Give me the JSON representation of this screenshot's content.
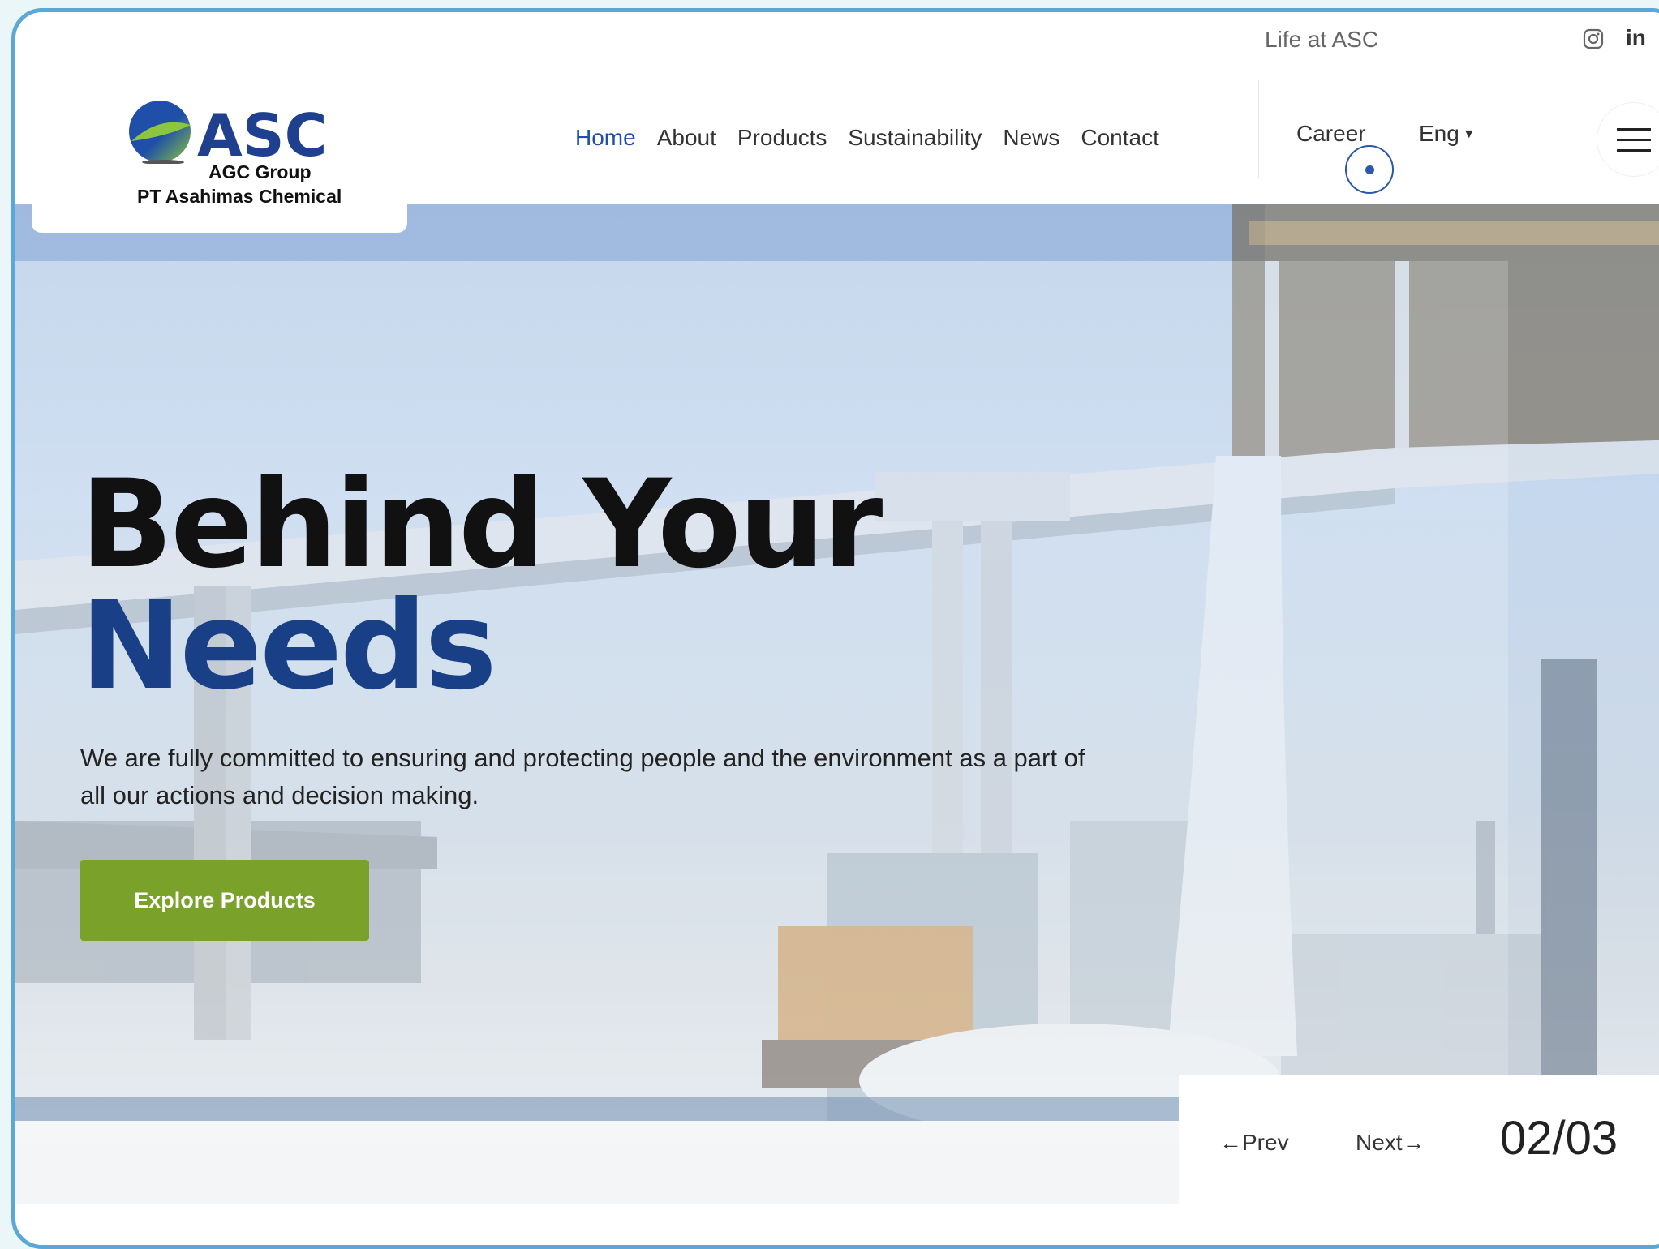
{
  "topbar": {
    "life_link": "Life at ASC",
    "social_icons": [
      "instagram-icon",
      "linkedin-icon"
    ],
    "linkedin_text": "in"
  },
  "logo": {
    "brand": "ASC",
    "group": "AGC Group",
    "company": "PT Asahimas Chemical"
  },
  "nav": {
    "items": [
      {
        "label": "Home",
        "active": true
      },
      {
        "label": "About"
      },
      {
        "label": "Products"
      },
      {
        "label": "Sustainability"
      },
      {
        "label": "News"
      },
      {
        "label": "Contact"
      }
    ],
    "career": "Career",
    "language": "Eng"
  },
  "hero": {
    "title_line1": "Behind Your",
    "title_line2": "Needs",
    "description": "We are fully committed to ensuring and protecting people and the environment as a part of all our actions and decision making.",
    "cta_label": "Explore Products"
  },
  "slider": {
    "prev_label": "Prev",
    "next_label": "Next",
    "counter": "02/03"
  },
  "colors": {
    "accent_blue": "#1f4fa8",
    "title_blue": "#193f86",
    "cta_green": "#7aa22a",
    "frame_border": "#5aa7d8"
  }
}
